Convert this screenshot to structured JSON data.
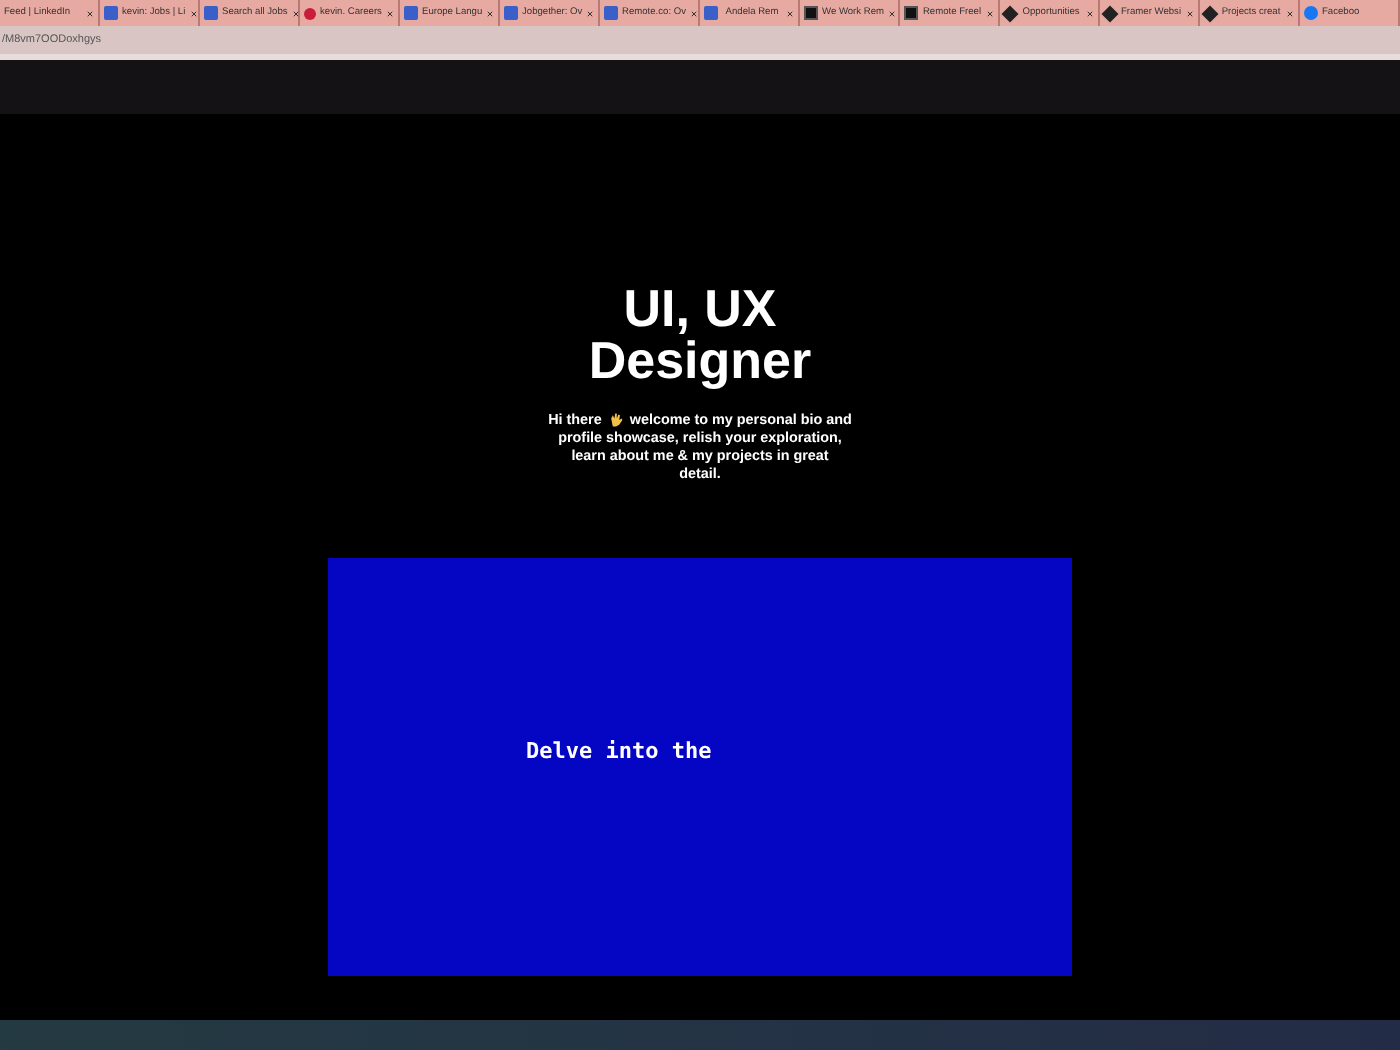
{
  "tabs": [
    {
      "title": "Feed | LinkedIn"
    },
    {
      "title": "kevin: Jobs | Li",
      "kind": "blue"
    },
    {
      "title": "Search all Jobs",
      "kind": "blue"
    },
    {
      "title": "kevin. Careers",
      "kind": "dot"
    },
    {
      "title": "Europe Langu",
      "kind": "blue"
    },
    {
      "title": "Jobgether: Ov",
      "kind": "blue"
    },
    {
      "title": "Remote.co: Ov",
      "kind": "blue"
    },
    {
      "title": "Andela Rem",
      "kind": "blue"
    },
    {
      "title": "We Work Rem",
      "kind": "square"
    },
    {
      "title": "Remote Freel",
      "kind": "square"
    },
    {
      "title": "Opportunities",
      "kind": "diamond"
    },
    {
      "title": "Framer Websi",
      "kind": "diamond"
    },
    {
      "title": "Projects creat",
      "kind": "diamond"
    },
    {
      "title": "Faceboo",
      "kind": "round"
    }
  ],
  "address": "/M8vm7OODoxhgys",
  "hero": {
    "title_line1": "UI, UX",
    "title_line2": "Designer",
    "greeting": "Hi there",
    "intro_line1": "welcome to my personal bio and",
    "intro_rest": "profile showcase, relish your exploration, learn about me & my projects in great detail."
  },
  "showcase": {
    "text": "Delve into the"
  }
}
